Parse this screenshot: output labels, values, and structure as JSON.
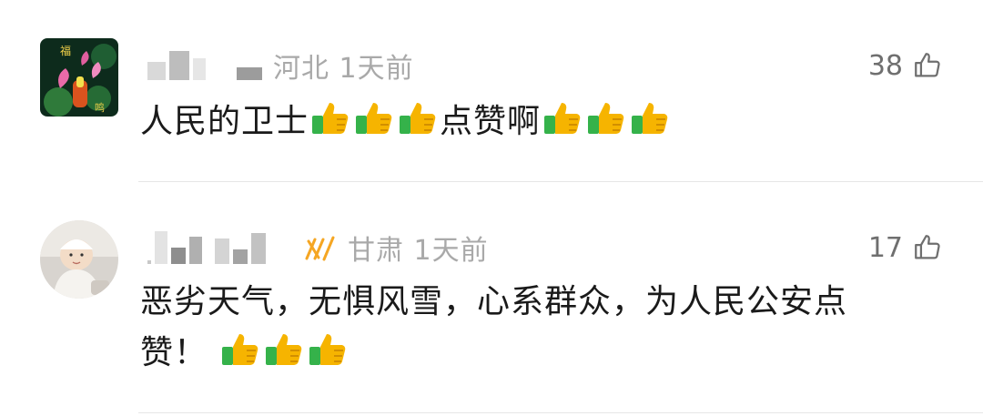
{
  "comments": [
    {
      "location_time": "河北 1天前",
      "likes": "38",
      "text_parts": [
        "人民的卫士",
        "点赞啊"
      ],
      "avatar_icon": "lotus-art-avatar",
      "emoji_icon": "thumbs-up-emoji"
    },
    {
      "badge_icon": "signal-badge-icon",
      "location_time": "甘肃 1天前",
      "likes": "17",
      "text_line1": "恶劣天气，无惧风雪，心系群众，为人民公安点",
      "text_line2": "赞！",
      "avatar_icon": "baby-photo-avatar",
      "emoji_icon": "thumbs-up-emoji"
    }
  ],
  "colors": {
    "meta_gray": "#a9a9a9",
    "count_gray": "#6f6f6f",
    "text": "#1a1a1a",
    "divider": "#e6e6e6",
    "badge_orange": "#f5a623"
  }
}
